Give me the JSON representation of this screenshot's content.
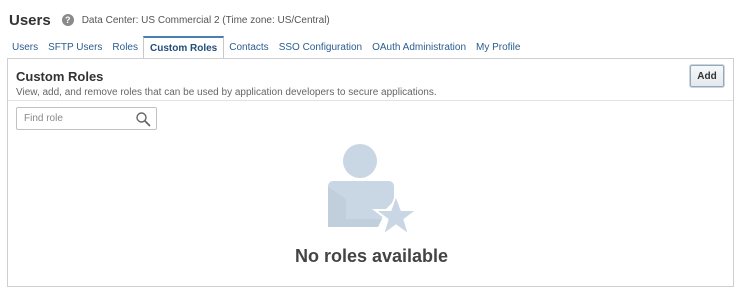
{
  "header": {
    "title": "Users",
    "help_icon": "?",
    "datacenter": "Data Center: US Commercial 2 (Time zone: US/Central)"
  },
  "tabs": [
    {
      "label": "Users",
      "active": false
    },
    {
      "label": "SFTP Users",
      "active": false
    },
    {
      "label": "Roles",
      "active": false
    },
    {
      "label": "Custom Roles",
      "active": true
    },
    {
      "label": "Contacts",
      "active": false
    },
    {
      "label": "SSO Configuration",
      "active": false
    },
    {
      "label": "OAuth Administration",
      "active": false
    },
    {
      "label": "My Profile",
      "active": false
    }
  ],
  "panel": {
    "title": "Custom Roles",
    "description": "View, add, and remove roles that can be used by application developers to secure applications.",
    "add_label": "Add",
    "search": {
      "placeholder": "Find role",
      "value": ""
    },
    "empty_message": "No roles available",
    "empty_icon": "user-star-icon"
  },
  "colors": {
    "accent": "#4a7fb5",
    "tab_link": "#2a5d8f",
    "illustration": "#c9d6e3"
  }
}
